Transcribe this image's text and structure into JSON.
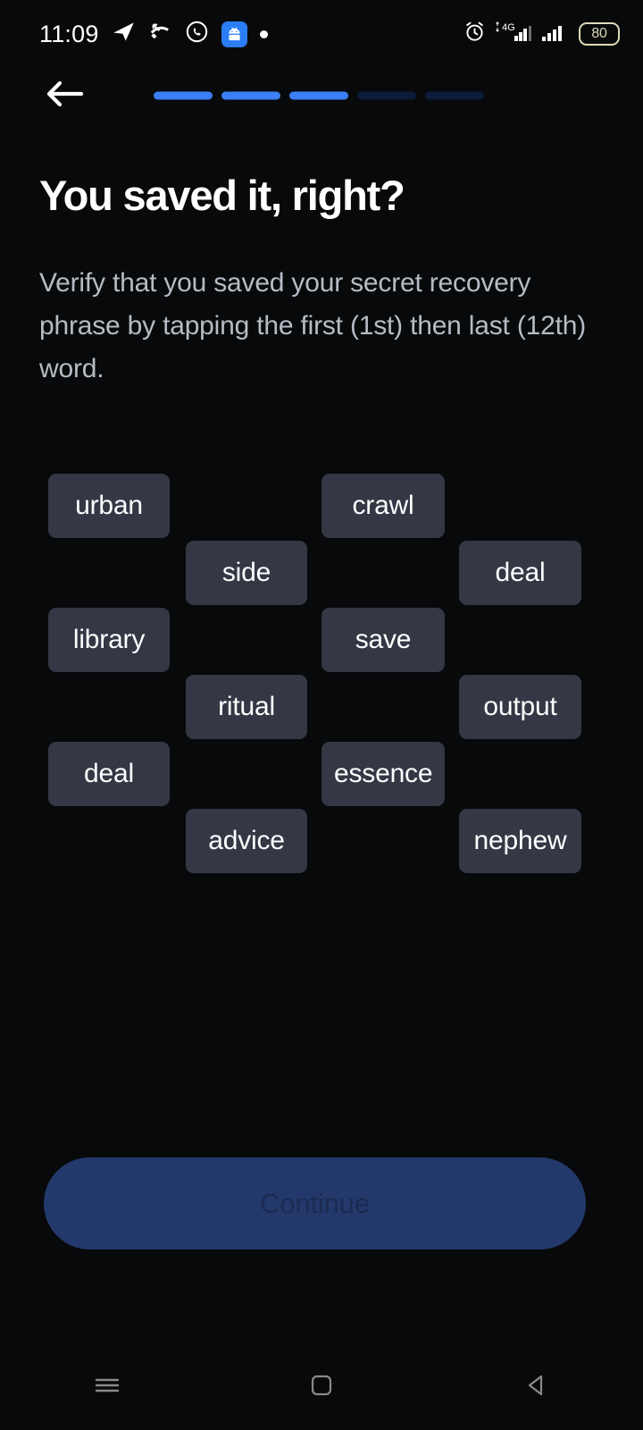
{
  "status_bar": {
    "time": "11:09",
    "left_icons": [
      "telegram-icon",
      "missed-call-icon",
      "whatsapp-icon",
      "android-icon",
      "dot-icon"
    ],
    "right_icons": [
      "alarm-icon",
      "signal-4g-icon",
      "signal-bars-icon"
    ],
    "network_label": "4G",
    "battery_level": "80"
  },
  "topbar": {
    "back_icon": "back-arrow-icon",
    "progress": {
      "total_steps": 5,
      "completed_steps": 3,
      "active_color": "#3b7ef5",
      "inactive_color": "#0d1b3a"
    }
  },
  "content": {
    "title": "You saved it, right?",
    "subtitle": "Verify that you saved your secret recovery phrase by tapping the first (1st) then last (12th) word."
  },
  "word_grid": {
    "chip_bg": "#343845",
    "chips": [
      {
        "label": "urban",
        "col": 1,
        "row": 0
      },
      {
        "label": "crawl",
        "col": 3,
        "row": 0
      },
      {
        "label": "side",
        "col": 2,
        "row": 1
      },
      {
        "label": "deal",
        "col": 4,
        "row": 1
      },
      {
        "label": "library",
        "col": 1,
        "row": 2
      },
      {
        "label": "save",
        "col": 3,
        "row": 2
      },
      {
        "label": "ritual",
        "col": 2,
        "row": 3
      },
      {
        "label": "output",
        "col": 4,
        "row": 3
      },
      {
        "label": "deal",
        "col": 1,
        "row": 4
      },
      {
        "label": "essence",
        "col": 3,
        "row": 4
      },
      {
        "label": "advice",
        "col": 2,
        "row": 5
      },
      {
        "label": "nephew",
        "col": 4,
        "row": 5
      }
    ]
  },
  "footer": {
    "continue_label": "Continue",
    "continue_enabled": false,
    "continue_bg": "#23396b"
  },
  "nav_bar": {
    "items": [
      "recents-icon",
      "home-icon",
      "back-icon"
    ]
  }
}
